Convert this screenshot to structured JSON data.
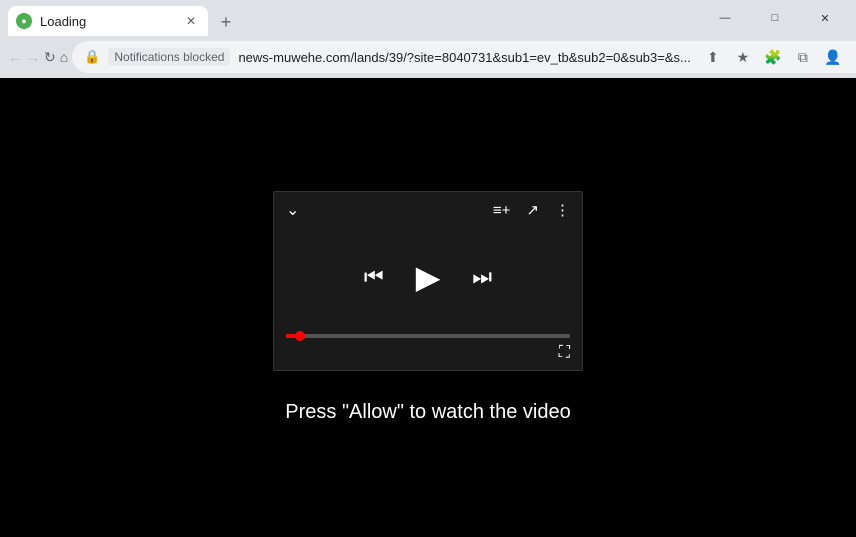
{
  "window": {
    "title": "Loading",
    "controls": {
      "minimize": "—",
      "maximize": "□",
      "close": "✕"
    }
  },
  "tab": {
    "favicon_color": "#4CAF50",
    "title": "Loading",
    "close_label": "✕",
    "new_tab_label": "+"
  },
  "nav": {
    "back_label": "←",
    "forward_label": "→",
    "reload_label": "↻",
    "home_label": "⌂",
    "notifications_blocked": "Notifications blocked",
    "url": "news-muwehe.com/lands/39/?site=8040731&sub1=ev_tb&sub2=0&sub3=&s...",
    "share_label": "⬆",
    "bookmark_label": "★",
    "extensions_label": "🧩",
    "split_label": "⧉",
    "profile_label": "👤",
    "menu_label": "⋮"
  },
  "player": {
    "chevron_down": "⌄",
    "add_to_queue": "≡+",
    "share": "↗",
    "more": "⋮",
    "prev": "⏮",
    "play": "▶",
    "next": "⏭",
    "fullscreen": "⛶",
    "progress_percent": 3
  },
  "prompt": {
    "text": "Press \"Allow\" to watch the video"
  }
}
